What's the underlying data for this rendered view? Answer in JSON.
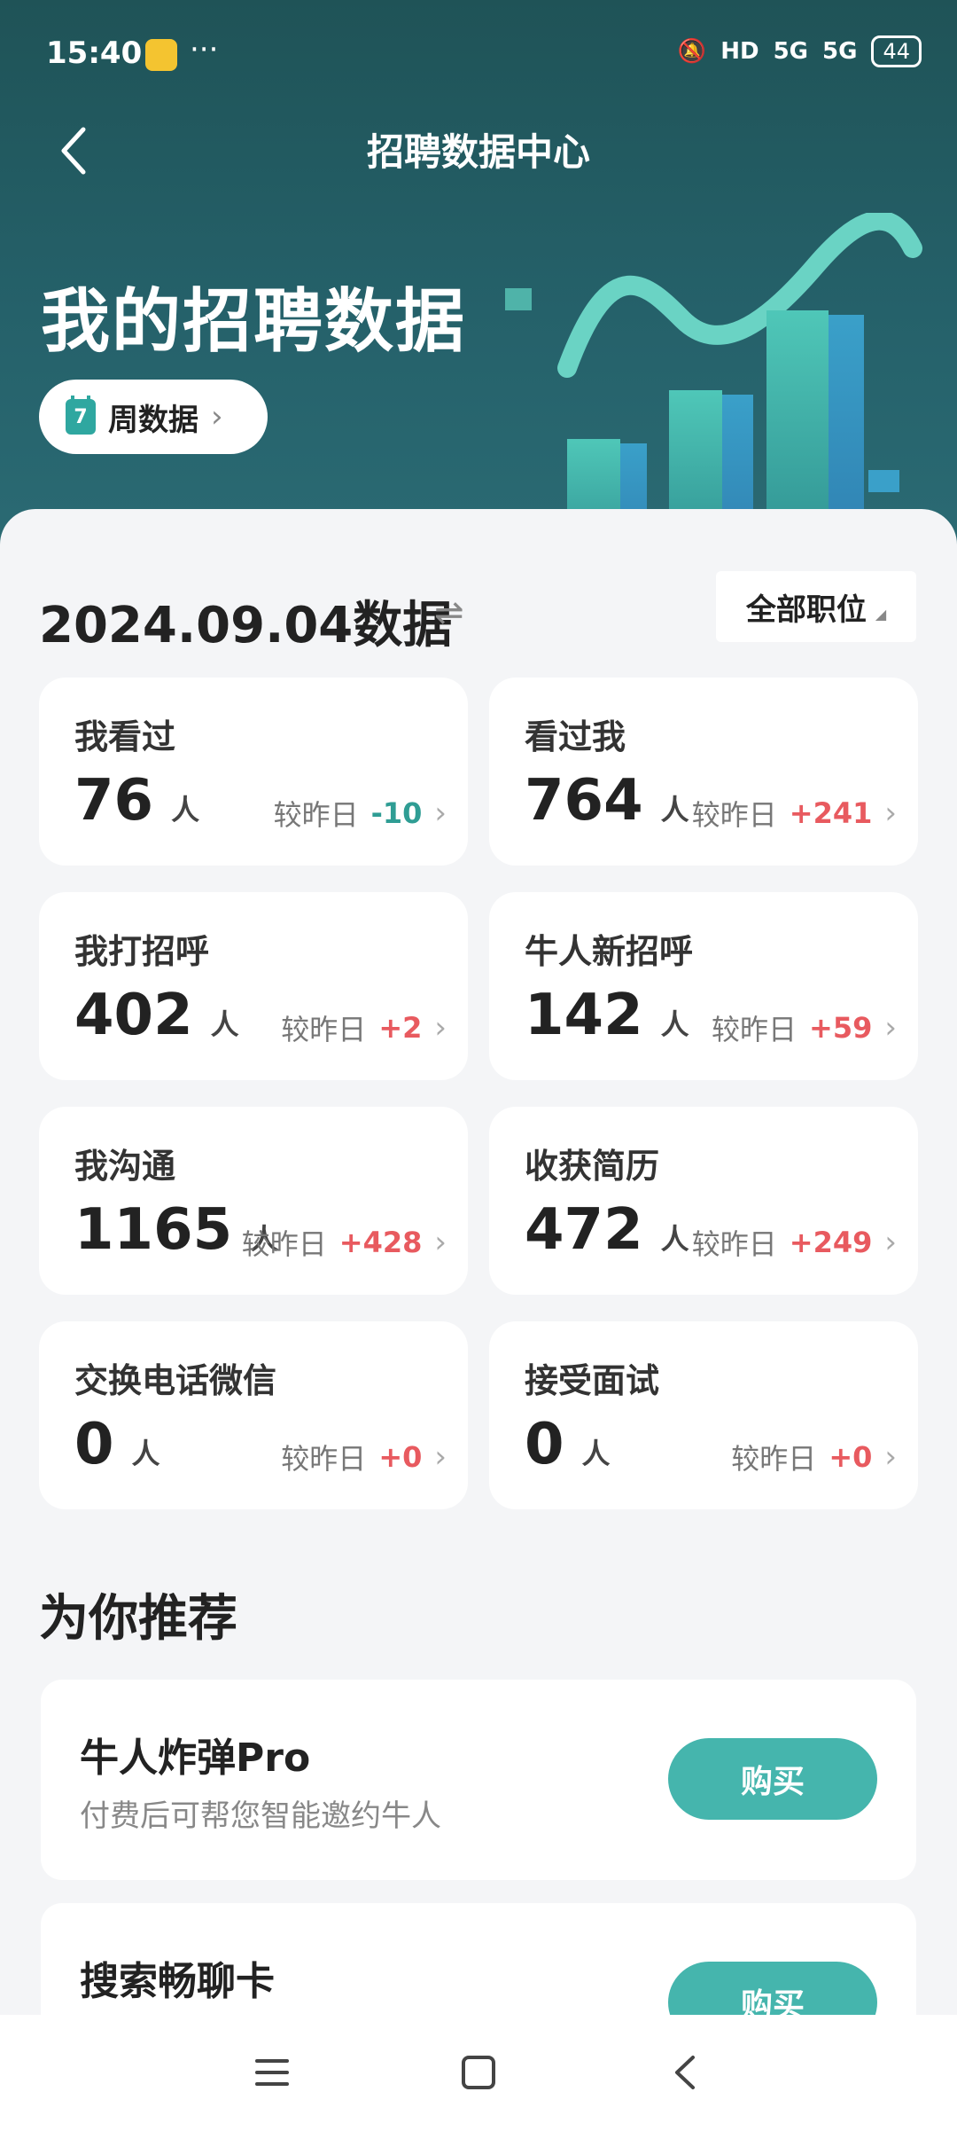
{
  "status_bar": {
    "time": "15:40",
    "dots": "···",
    "hd": "HD",
    "sig1": "5G",
    "sig2": "5G",
    "battery": "44"
  },
  "header": {
    "title": "招聘数据中心",
    "hero_title": "我的招聘数据",
    "period_button": "周数据",
    "calendar_day": "7"
  },
  "summary": {
    "date_label": "2024.09.04数据",
    "swap_symbol": "⇌",
    "job_filter": "全部职位"
  },
  "stats": [
    {
      "label": "我看过",
      "value": "76",
      "unit": "人",
      "compare_label": "较昨日",
      "delta": "-10",
      "trend": "neg"
    },
    {
      "label": "看过我",
      "value": "764",
      "unit": "人",
      "compare_label": "较昨日",
      "delta": "+241",
      "trend": "pos"
    },
    {
      "label": "我打招呼",
      "value": "402",
      "unit": "人",
      "compare_label": "较昨日",
      "delta": "+2",
      "trend": "pos"
    },
    {
      "label": "牛人新招呼",
      "value": "142",
      "unit": "人",
      "compare_label": "较昨日",
      "delta": "+59",
      "trend": "pos"
    },
    {
      "label": "我沟通",
      "value": "1165",
      "unit": "人",
      "compare_label": "较昨日",
      "delta": "+428",
      "trend": "pos"
    },
    {
      "label": "收获简历",
      "value": "472",
      "unit": "人",
      "compare_label": "较昨日",
      "delta": "+249",
      "trend": "pos"
    },
    {
      "label": "交换电话微信",
      "value": "0",
      "unit": "人",
      "compare_label": "较昨日",
      "delta": "+0",
      "trend": "pos"
    },
    {
      "label": "接受面试",
      "value": "0",
      "unit": "人",
      "compare_label": "较昨日",
      "delta": "+0",
      "trend": "pos"
    }
  ],
  "recommend": {
    "title": "为你推荐",
    "items": [
      {
        "name": "牛人炸弹Pro",
        "desc": "付费后可帮您智能邀约牛人",
        "button": "购买"
      },
      {
        "name": "搜索畅聊卡",
        "desc": "",
        "button": "购买"
      }
    ]
  },
  "colors": {
    "accent": "#45b5ad",
    "header_bg": "#25616a",
    "positive": "#e85a5f",
    "negative": "#2f9d94"
  },
  "icons": {
    "back": "chevron-left-icon",
    "period_arrow": "chevron-right-icon",
    "dropdown": "triangle-down-icon",
    "nav_menu": "menu-icon",
    "nav_home": "home-square-icon",
    "nav_back": "back-icon"
  }
}
